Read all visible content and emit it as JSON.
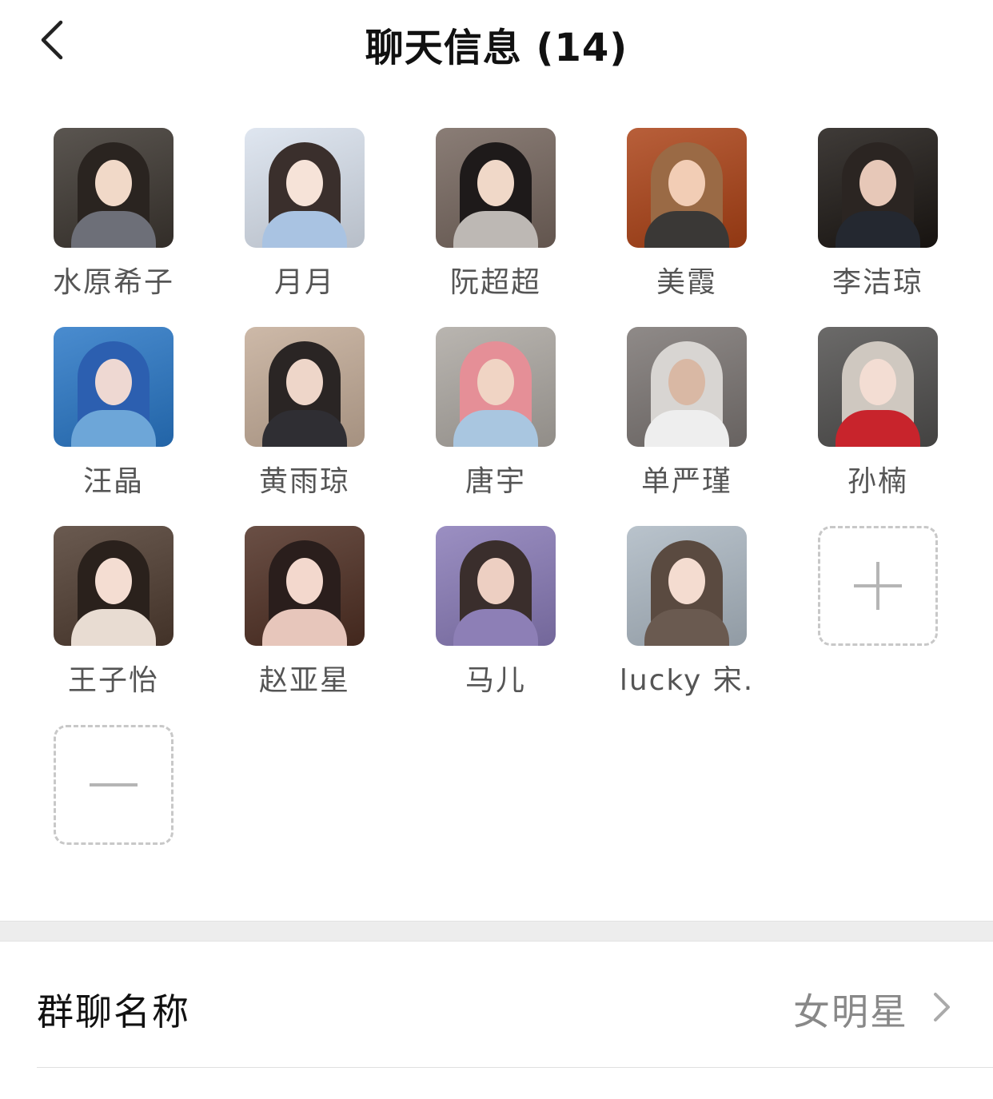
{
  "header": {
    "title": "聊天信息 (14)",
    "back_icon": "chevron-left-icon"
  },
  "members": [
    {
      "name": "水原希子",
      "colors": [
        "#5a5550",
        "#2a2420",
        "#f1d9c8",
        "#6d6f78"
      ]
    },
    {
      "name": "月月",
      "colors": [
        "#dfe6f0",
        "#3a2f2c",
        "#f6e3d8",
        "#a9c3e2"
      ]
    },
    {
      "name": "阮超超",
      "colors": [
        "#8a7d76",
        "#1e1a1a",
        "#f0d8c8",
        "#bdb8b4"
      ]
    },
    {
      "name": "美霞",
      "colors": [
        "#b85f3a",
        "#9a6a45",
        "#f2cdb5",
        "#3a3836"
      ]
    },
    {
      "name": "李洁琼",
      "colors": [
        "#3f3b38",
        "#2b2522",
        "#e7c8b8",
        "#242830"
      ]
    },
    {
      "name": "汪晶",
      "colors": [
        "#4a8ccf",
        "#2c5fb0",
        "#eed8d2",
        "#6da6d8"
      ]
    },
    {
      "name": "黄雨琼",
      "colors": [
        "#cdb9a8",
        "#2a2524",
        "#eed6c9",
        "#2f2e33"
      ]
    },
    {
      "name": "唐宇",
      "colors": [
        "#b9b5b0",
        "#e58f97",
        "#f0d4c4",
        "#a9c6e0"
      ]
    },
    {
      "name": "单严瑾",
      "colors": [
        "#8f8a88",
        "#d8d5d2",
        "#d9b8a4",
        "#eeeeee"
      ]
    },
    {
      "name": "孙楠",
      "colors": [
        "#6b6a69",
        "#cfc8c0",
        "#f3ddd3",
        "#c8242c"
      ]
    },
    {
      "name": "王子怡",
      "colors": [
        "#6a5a50",
        "#2a211c",
        "#f4ddd2",
        "#e8dcd2"
      ]
    },
    {
      "name": "赵亚星",
      "colors": [
        "#6a4f45",
        "#2a1e1c",
        "#f3d8cd",
        "#e7c6bb"
      ]
    },
    {
      "name": "马儿",
      "colors": [
        "#9b8fc2",
        "#3a2e2c",
        "#edcfc2",
        "#8d7fb6"
      ]
    },
    {
      "name": "lucky 宋.",
      "colors": [
        "#b9c3cc",
        "#5a4a40",
        "#f4dcd0",
        "#6a5a50"
      ]
    }
  ],
  "add_member": {
    "icon": "plus-icon"
  },
  "remove_member": {
    "icon": "minus-icon"
  },
  "group_name_row": {
    "label": "群聊名称",
    "value": "女明星",
    "chevron_icon": "chevron-right-icon"
  }
}
